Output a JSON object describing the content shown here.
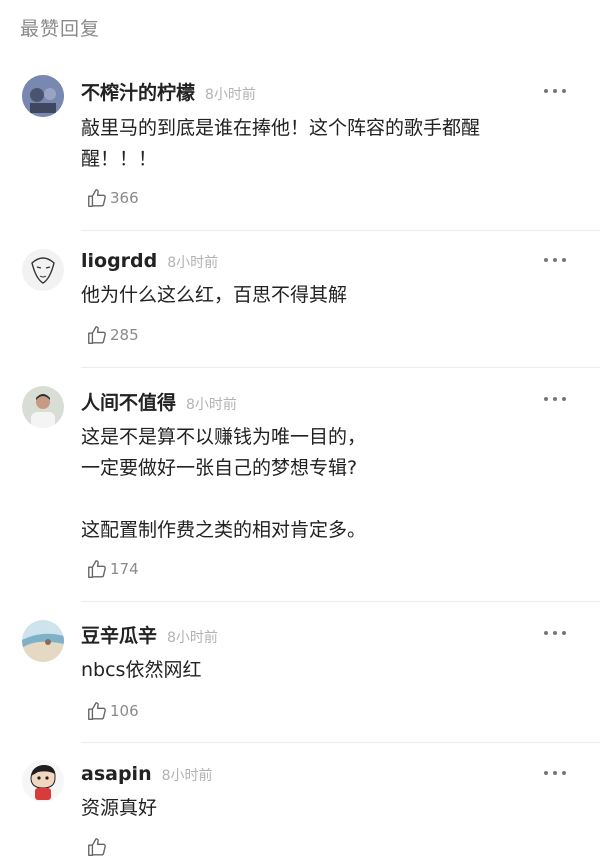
{
  "section_title": "最赞回复",
  "comments": [
    {
      "username": "不榨汁的柠檬",
      "time": "8小时前",
      "text": "敲里马的到底是谁在捧他！这个阵容的歌手都醒醒！！！",
      "likes": "366"
    },
    {
      "username": "liogrdd",
      "time": "8小时前",
      "text": "他为什么这么红，百思不得其解",
      "likes": "285"
    },
    {
      "username": "人间不值得",
      "time": "8小时前",
      "text": "这是不是算不以赚钱为唯一目的，\n一定要做好一张自己的梦想专辑?\n\n这配置制作费之类的相对肯定多。",
      "likes": "174"
    },
    {
      "username": "豆辛瓜辛",
      "time": "8小时前",
      "text": "nbcs依然网红",
      "likes": "106"
    },
    {
      "username": "asapin",
      "time": "8小时前",
      "text": "资源真好",
      "likes": ""
    }
  ],
  "icons": {
    "like": "thumbs-up-icon",
    "more": "more-dots-icon"
  },
  "colors": {
    "text": "#222222",
    "muted": "#8a8a8a",
    "time": "#b3b3b3",
    "divider": "#ececec"
  }
}
